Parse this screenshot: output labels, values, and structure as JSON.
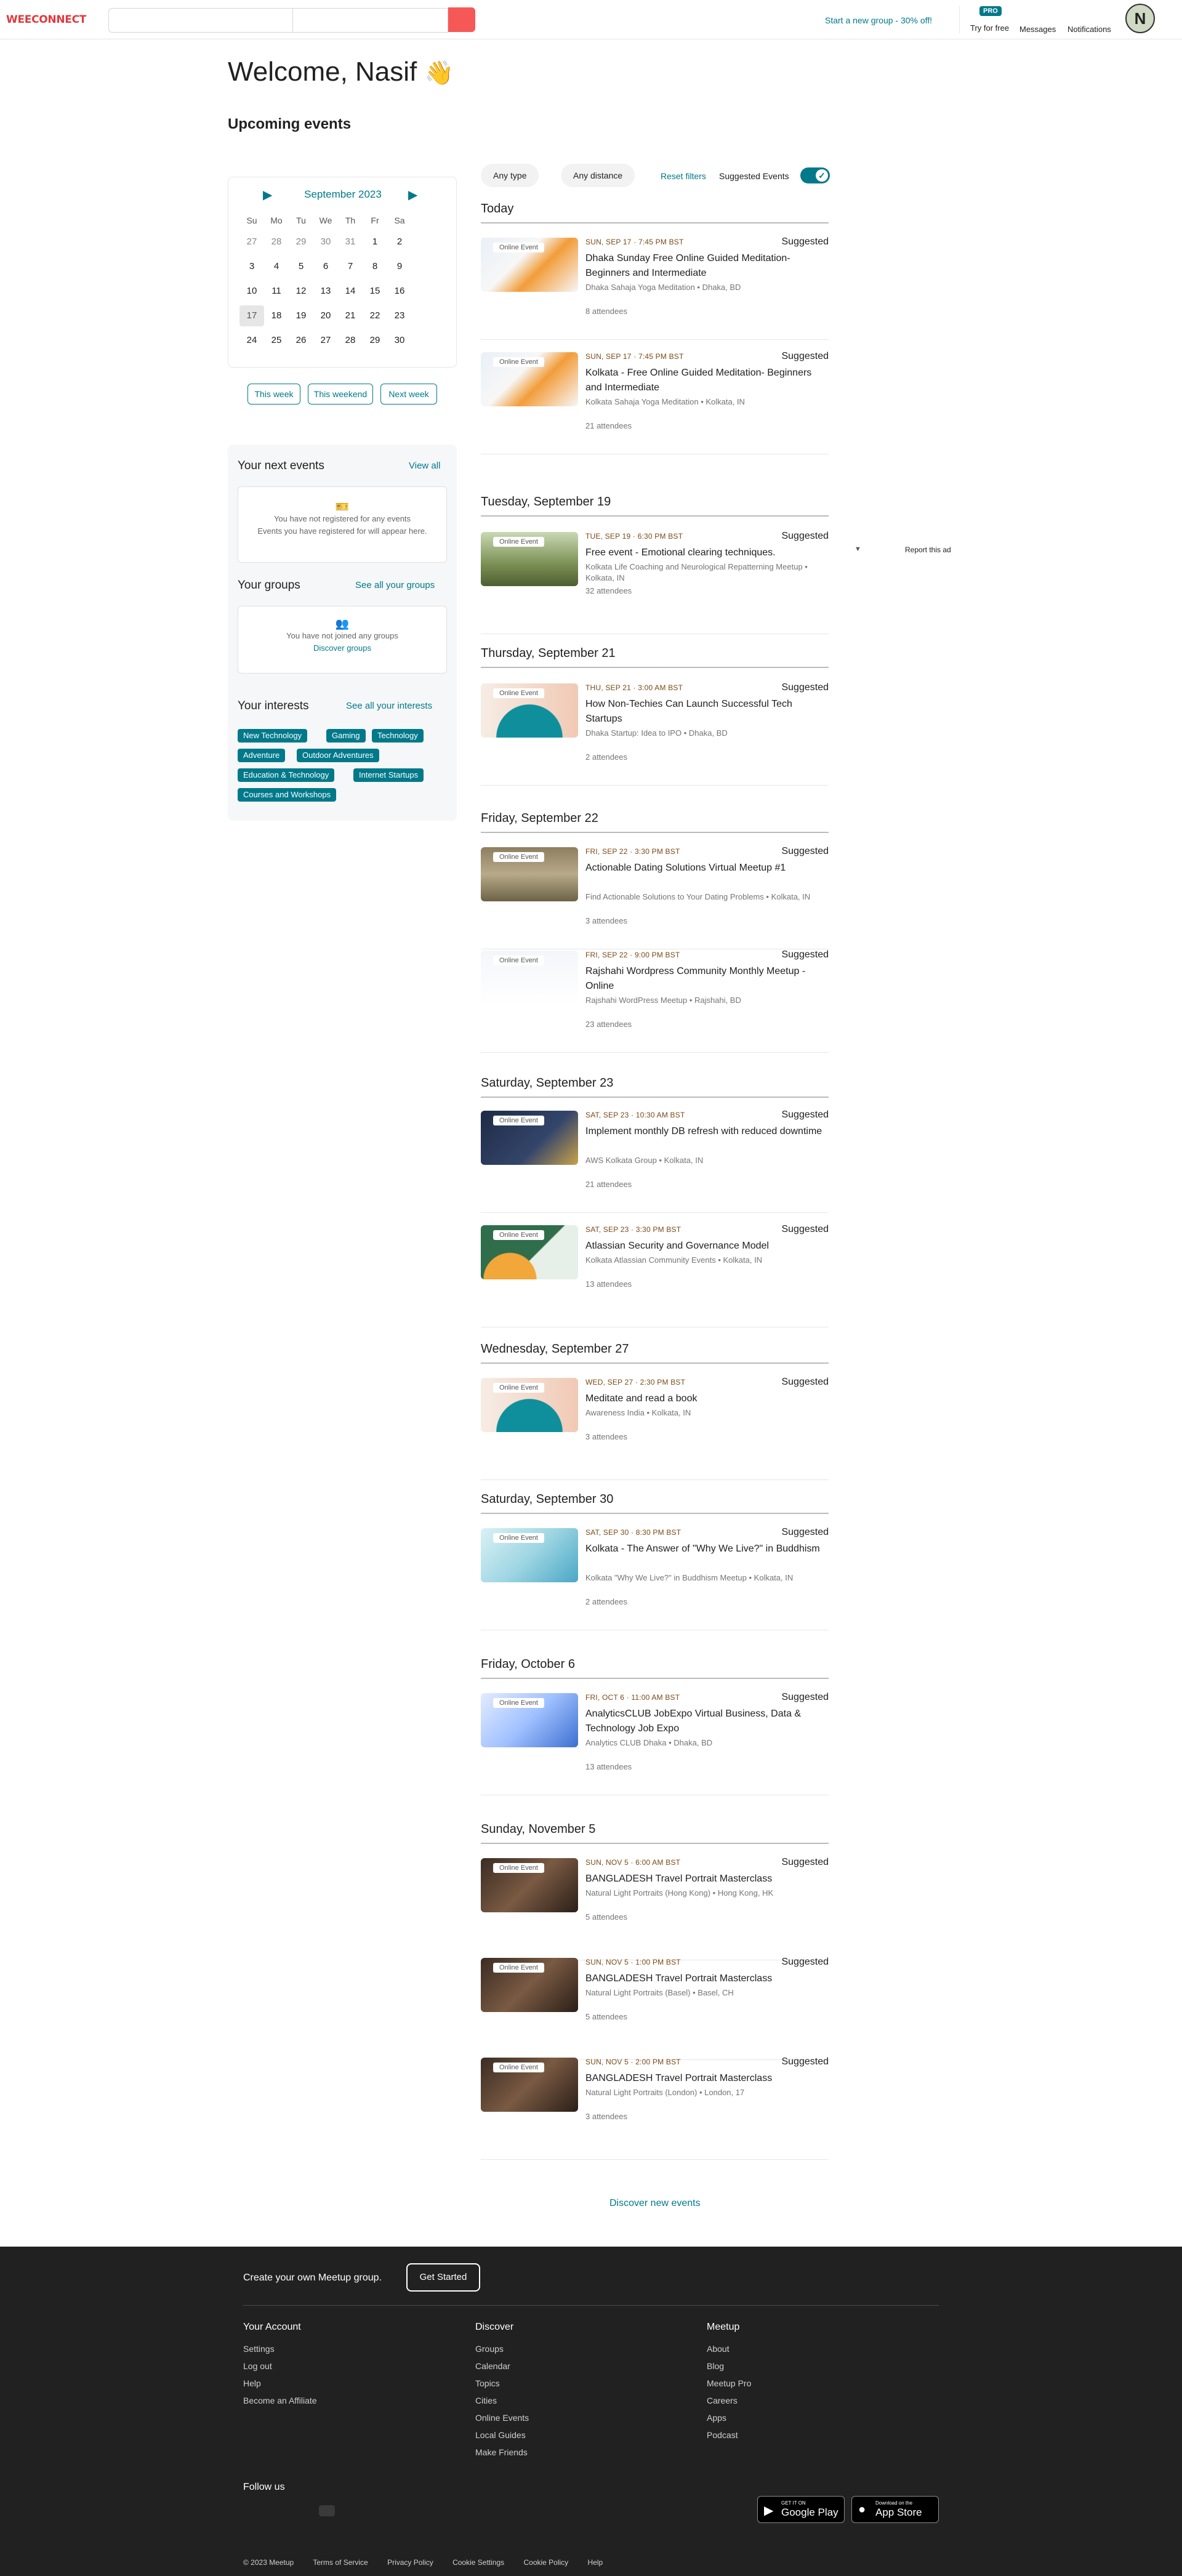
{
  "header": {
    "logo": "WEECONNECT",
    "promo": "Start a new group - 30% off!",
    "pro_badge": "PRO",
    "try_free": "Try for free",
    "messages": "Messages",
    "notifications": "Notifications",
    "avatar_letter": "N"
  },
  "welcome": "Welcome, Nasif",
  "upcoming_title": "Upcoming events",
  "calendar": {
    "month": "September 2023",
    "weekdays": [
      "Su",
      "Mo",
      "Tu",
      "We",
      "Th",
      "Fr",
      "Sa"
    ],
    "weeks": [
      [
        "27",
        "28",
        "29",
        "30",
        "31",
        "1",
        "2"
      ],
      [
        "3",
        "4",
        "5",
        "6",
        "7",
        "8",
        "9"
      ],
      [
        "10",
        "11",
        "12",
        "13",
        "14",
        "15",
        "16"
      ],
      [
        "17",
        "18",
        "19",
        "20",
        "21",
        "22",
        "23"
      ],
      [
        "24",
        "25",
        "26",
        "27",
        "28",
        "29",
        "30"
      ]
    ],
    "today": "17",
    "quick": [
      "This week",
      "This weekend",
      "Next week"
    ]
  },
  "sidebar": {
    "next_events_title": "Your next events",
    "view_all": "View all",
    "no_events_1": "You have not registered for any events",
    "no_events_2": "Events you have registered for will appear here.",
    "groups_title": "Your groups",
    "see_groups": "See all your groups",
    "no_groups": "You have not joined any groups",
    "discover_groups": "Discover groups",
    "interests_title": "Your interests",
    "see_interests": "See all your interests",
    "interests": [
      "New Technology",
      "Gaming",
      "Technology",
      "Adventure",
      "Outdoor Adventures",
      "Education & Technology",
      "Internet Startups",
      "Courses and Workshops"
    ]
  },
  "filters": {
    "type": "Any type",
    "distance": "Any distance",
    "reset": "Reset filters",
    "suggested": "Suggested Events"
  },
  "online_label": "Online Event",
  "suggested_label": "Suggested",
  "ad": {
    "report": "Report this ad"
  },
  "days": [
    {
      "label": "Today",
      "events": [
        {
          "date": "SUN, SEP 17 · 7:45 PM BST",
          "title": "Dhaka Sunday Free Online Guided Meditation-Beginners and Intermediate",
          "group": "Dhaka Sahaja Yoga Meditation • Dhaka, BD",
          "attendees": "8 attendees"
        },
        {
          "date": "SUN, SEP 17 · 7:45 PM BST",
          "title": "Kolkata - Free Online Guided Meditation- Beginners and Intermediate",
          "group": "Kolkata Sahaja Yoga Meditation • Kolkata, IN",
          "attendees": "21 attendees"
        }
      ]
    },
    {
      "label": "Tuesday, September 19",
      "events": [
        {
          "date": "TUE, SEP 19 · 6:30 PM BST",
          "title": "Free event - Emotional clearing techniques.",
          "group": "Kolkata Life Coaching and Neurological Repatterning Meetup • Kolkata, IN",
          "attendees": "32 attendees"
        }
      ]
    },
    {
      "label": "Thursday, September 21",
      "events": [
        {
          "date": "THU, SEP 21 · 3:00 AM BST",
          "title": "How Non-Techies Can Launch Successful Tech Startups",
          "group": "Dhaka Startup: Idea to IPO • Dhaka, BD",
          "attendees": "2 attendees"
        }
      ]
    },
    {
      "label": "Friday, September 22",
      "events": [
        {
          "date": "FRI, SEP 22 · 3:30 PM BST",
          "title": "Actionable Dating Solutions Virtual Meetup #1",
          "group": "Find Actionable Solutions to Your Dating Problems • Kolkata, IN",
          "attendees": "3 attendees"
        },
        {
          "date": "FRI, SEP 22 · 9:00 PM BST",
          "title": "Rajshahi Wordpress Community Monthly Meetup - Online",
          "group": "Rajshahi WordPress Meetup • Rajshahi, BD",
          "attendees": "23 attendees"
        }
      ]
    },
    {
      "label": "Saturday, September 23",
      "events": [
        {
          "date": "SAT, SEP 23 · 10:30 AM BST",
          "title": "Implement monthly DB refresh with reduced downtime",
          "group": "AWS Kolkata Group • Kolkata, IN",
          "attendees": "21 attendees"
        },
        {
          "date": "SAT, SEP 23 · 3:30 PM BST",
          "title": "Atlassian Security and Governance Model",
          "group": "Kolkata Atlassian Community Events • Kolkata, IN",
          "attendees": "13 attendees"
        }
      ]
    },
    {
      "label": "Wednesday, September 27",
      "events": [
        {
          "date": "WED, SEP 27 · 2:30 PM BST",
          "title": "Meditate and read a book",
          "group": "Awareness India • Kolkata, IN",
          "attendees": "3 attendees"
        }
      ]
    },
    {
      "label": "Saturday, September 30",
      "events": [
        {
          "date": "SAT, SEP 30 · 8:30 PM BST",
          "title": "Kolkata - The Answer of \"Why We Live?\" in Buddhism",
          "group": "Kolkata \"Why We Live?\" in Buddhism Meetup • Kolkata, IN",
          "attendees": "2 attendees"
        }
      ]
    },
    {
      "label": "Friday, October 6",
      "events": [
        {
          "date": "FRI, OCT 6 · 11:00 AM BST",
          "title": "AnalyticsCLUB JobExpo Virtual Business, Data & Technology Job Expo",
          "group": "Analytics CLUB Dhaka • Dhaka, BD",
          "attendees": "13 attendees"
        }
      ]
    },
    {
      "label": "Sunday, November 5",
      "events": [
        {
          "date": "SUN, NOV 5 · 6:00 AM BST",
          "title": "BANGLADESH Travel Portrait Masterclass",
          "group": "Natural Light Portraits (Hong Kong) • Hong Kong, HK",
          "attendees": "5 attendees"
        },
        {
          "date": "SUN, NOV 5 · 1:00 PM BST",
          "title": "BANGLADESH Travel Portrait Masterclass",
          "group": "Natural Light Portraits (Basel) • Basel, CH",
          "attendees": "5 attendees"
        },
        {
          "date": "SUN, NOV 5 · 2:00 PM BST",
          "title": "BANGLADESH Travel Portrait Masterclass",
          "group": "Natural Light Portraits (London) • London, 17",
          "attendees": "3 attendees"
        }
      ]
    }
  ],
  "discover_events": "Discover new events",
  "footer": {
    "create": "Create your own Meetup group.",
    "get_started": "Get Started",
    "cols": [
      {
        "title": "Your Account",
        "links": [
          "Settings",
          "Log out",
          "Help",
          "Become an Affiliate"
        ]
      },
      {
        "title": "Discover",
        "links": [
          "Groups",
          "Calendar",
          "Topics",
          "Cities",
          "Online Events",
          "Local Guides",
          "Make Friends"
        ]
      },
      {
        "title": "Meetup",
        "links": [
          "About",
          "Blog",
          "Meetup Pro",
          "Careers",
          "Apps",
          "Podcast"
        ]
      }
    ],
    "follow": "Follow us",
    "google_small": "GET IT ON",
    "google_big": "Google Play",
    "apple_small": "Download on the",
    "apple_big": "App Store",
    "bottom": [
      "© 2023 Meetup",
      "Terms of Service",
      "Privacy Policy",
      "Cookie Settings",
      "Cookie Policy",
      "Help"
    ]
  }
}
